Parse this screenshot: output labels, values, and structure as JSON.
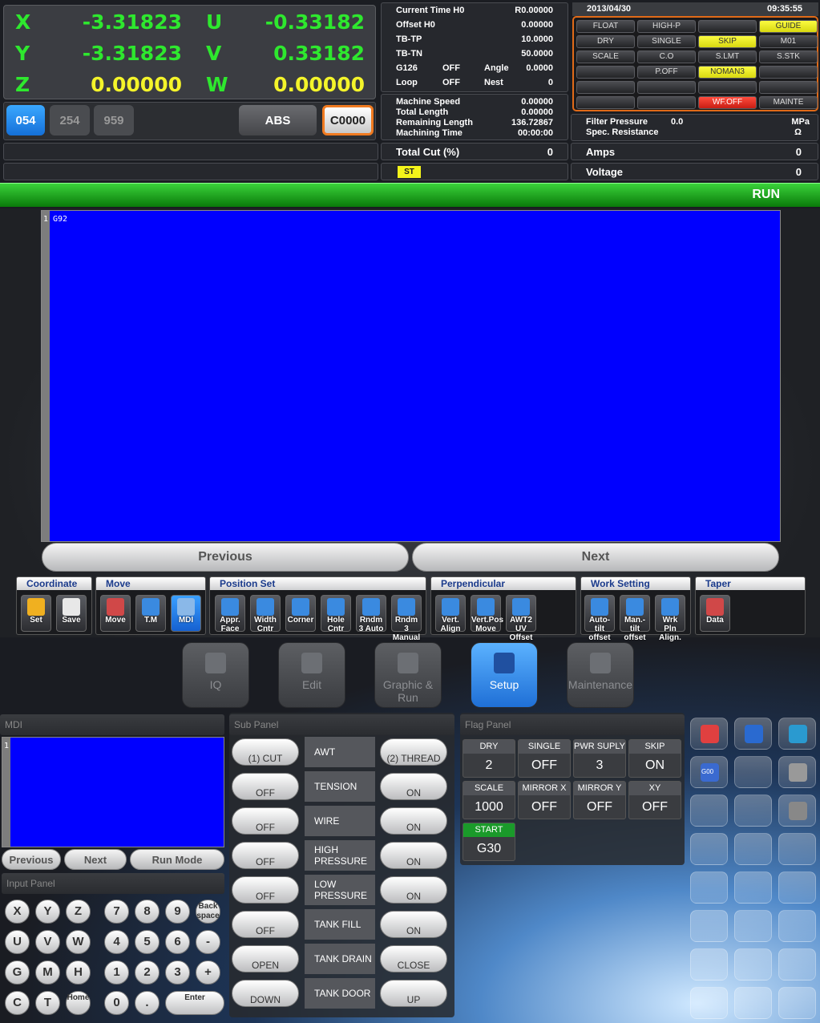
{
  "axes": [
    {
      "label": "X",
      "value": "-3.31823",
      "color": "green"
    },
    {
      "label": "U",
      "value": "-0.33182",
      "color": "green"
    },
    {
      "label": "Y",
      "value": "-3.31823",
      "color": "green"
    },
    {
      "label": "V",
      "value": "0.33182",
      "color": "green"
    },
    {
      "label": "Z",
      "value": "0.00000",
      "color": "yellow"
    },
    {
      "label": "W",
      "value": "0.00000",
      "color": "yellow"
    }
  ],
  "coord_buttons": {
    "b1": "054",
    "b2": "254",
    "b3": "959",
    "abs": "ABS",
    "code": "C0000"
  },
  "info": {
    "current_time_l": "Current Time  H0",
    "current_time_v": "R0.00000",
    "offset_l": "Offset  H0",
    "offset_v": "0.00000",
    "tbtp_l": "TB-TP",
    "tbtp_v": "10.0000",
    "tbtn_l": "TB-TN",
    "tbtn_v": "50.0000",
    "g126_l": "G126",
    "g126_v": "OFF",
    "angle_l": "Angle",
    "angle_v": "0.0000",
    "loop_l": "Loop",
    "loop_v": "OFF",
    "nest_l": "Nest",
    "nest_v": "0",
    "ms_l": "Machine Speed",
    "ms_v": "0.00000",
    "tl_l": "Total Length",
    "tl_v": "0.00000",
    "rl_l": "Remaining Length",
    "rl_v": "136.72867",
    "mt_l": "Machining Time",
    "mt_v": "00:00:00",
    "tc_l": "Total Cut (%)",
    "tc_v": "0",
    "st": "ST"
  },
  "status": {
    "date": "2013/04/30",
    "time": "09:35:55",
    "cells": [
      {
        "t": "FLOAT",
        "s": "n"
      },
      {
        "t": "HIGH-P",
        "s": "n"
      },
      {
        "t": "",
        "s": "n"
      },
      {
        "t": "GUIDE",
        "s": "y"
      },
      {
        "t": "DRY",
        "s": "n"
      },
      {
        "t": "SINGLE",
        "s": "n"
      },
      {
        "t": "SKIP",
        "s": "y"
      },
      {
        "t": "M01",
        "s": "n"
      },
      {
        "t": "SCALE",
        "s": "n"
      },
      {
        "t": "C.O",
        "s": "n"
      },
      {
        "t": "S.LMT",
        "s": "n"
      },
      {
        "t": "S.STK",
        "s": "n"
      },
      {
        "t": "",
        "s": "n"
      },
      {
        "t": "P.OFF",
        "s": "n"
      },
      {
        "t": "NOMAN3",
        "s": "y"
      },
      {
        "t": "",
        "s": "n"
      },
      {
        "t": "",
        "s": "n"
      },
      {
        "t": "",
        "s": "n"
      },
      {
        "t": "",
        "s": "n"
      },
      {
        "t": "",
        "s": "n"
      },
      {
        "t": "",
        "s": "n"
      },
      {
        "t": "",
        "s": "n"
      },
      {
        "t": "WF.OFF",
        "s": "r"
      },
      {
        "t": "MAINTE",
        "s": "n"
      }
    ],
    "fp_l": "Filter Pressure",
    "fp_v": "0.0",
    "fp_u": "MPa",
    "sr_l": "Spec. Resistance",
    "sr_u": "Ω",
    "amps_l": "Amps",
    "amps_v": "0",
    "volt_l": "Voltage",
    "volt_v": "0"
  },
  "run_status": "RUN",
  "editor": {
    "line": "1",
    "text": "G92"
  },
  "nav": {
    "prev": "Previous",
    "next": "Next"
  },
  "toolbar": {
    "g_coord": "Coordinate",
    "g_move": "Move",
    "g_pos": "Position Set",
    "g_perp": "Perpendicular",
    "g_work": "Work Setting",
    "g_taper": "Taper",
    "b": [
      "Set",
      "Save",
      "Move",
      "T.M",
      "MDI",
      "Appr. Face",
      "Width Cntr",
      "Corner",
      "Hole Cntr",
      "Rndm 3 Auto",
      "Rndm 3 Manual",
      "Vert. Align",
      "Vert.Pos Move",
      "AWT2 UV Offset",
      "Auto-tilt offset",
      "Man.-tilt offset",
      "Wrk Pln Align.",
      "Data"
    ]
  },
  "tabs": {
    "iq": "IQ",
    "edit": "Edit",
    "graphic": "Graphic & Run",
    "setup": "Setup",
    "maint": "Maintenance"
  },
  "mdi": {
    "title": "MDI",
    "line": "1",
    "prev": "Previous",
    "next": "Next",
    "run": "Run Mode"
  },
  "input_panel": {
    "title": "Input Panel",
    "keys": [
      "X",
      "Y",
      "Z",
      "7",
      "8",
      "9",
      "Back space",
      "U",
      "V",
      "W",
      "4",
      "5",
      "6",
      "-",
      "G",
      "M",
      "H",
      "1",
      "2",
      "3",
      "+",
      "C",
      "T",
      "Home",
      "0",
      ".",
      "Enter"
    ]
  },
  "sub_panel": {
    "title": "Sub Panel",
    "rows": [
      {
        "left": "(1) CUT",
        "label": "AWT",
        "right": "(2) THREAD"
      },
      {
        "left": "OFF",
        "label": "TENSION",
        "right": "ON"
      },
      {
        "left": "OFF",
        "label": "WIRE",
        "right": "ON"
      },
      {
        "left": "OFF",
        "label": "HIGH PRESSURE",
        "right": "ON"
      },
      {
        "left": "OFF",
        "label": "LOW PRESSURE",
        "right": "ON"
      },
      {
        "left": "OFF",
        "label": "TANK FILL",
        "right": "ON"
      },
      {
        "left": "OPEN",
        "label": "TANK DRAIN",
        "right": "CLOSE"
      },
      {
        "left": "DOWN",
        "label": "TANK DOOR",
        "right": "UP"
      }
    ]
  },
  "flag_panel": {
    "title": "Flag Panel",
    "flags": [
      {
        "t": "DRY",
        "v": "2"
      },
      {
        "t": "SINGLE",
        "v": "OFF"
      },
      {
        "t": "PWR SUPLY",
        "v": "3"
      },
      {
        "t": "SKIP",
        "v": "ON"
      },
      {
        "t": "SCALE",
        "v": "1000"
      },
      {
        "t": "MIRROR X",
        "v": "OFF"
      },
      {
        "t": "MIRROR Y",
        "v": "OFF"
      },
      {
        "t": "XY",
        "v": "OFF"
      },
      {
        "t": "START",
        "v": "G30"
      }
    ]
  },
  "right_keys": {
    "g00": "G00"
  }
}
